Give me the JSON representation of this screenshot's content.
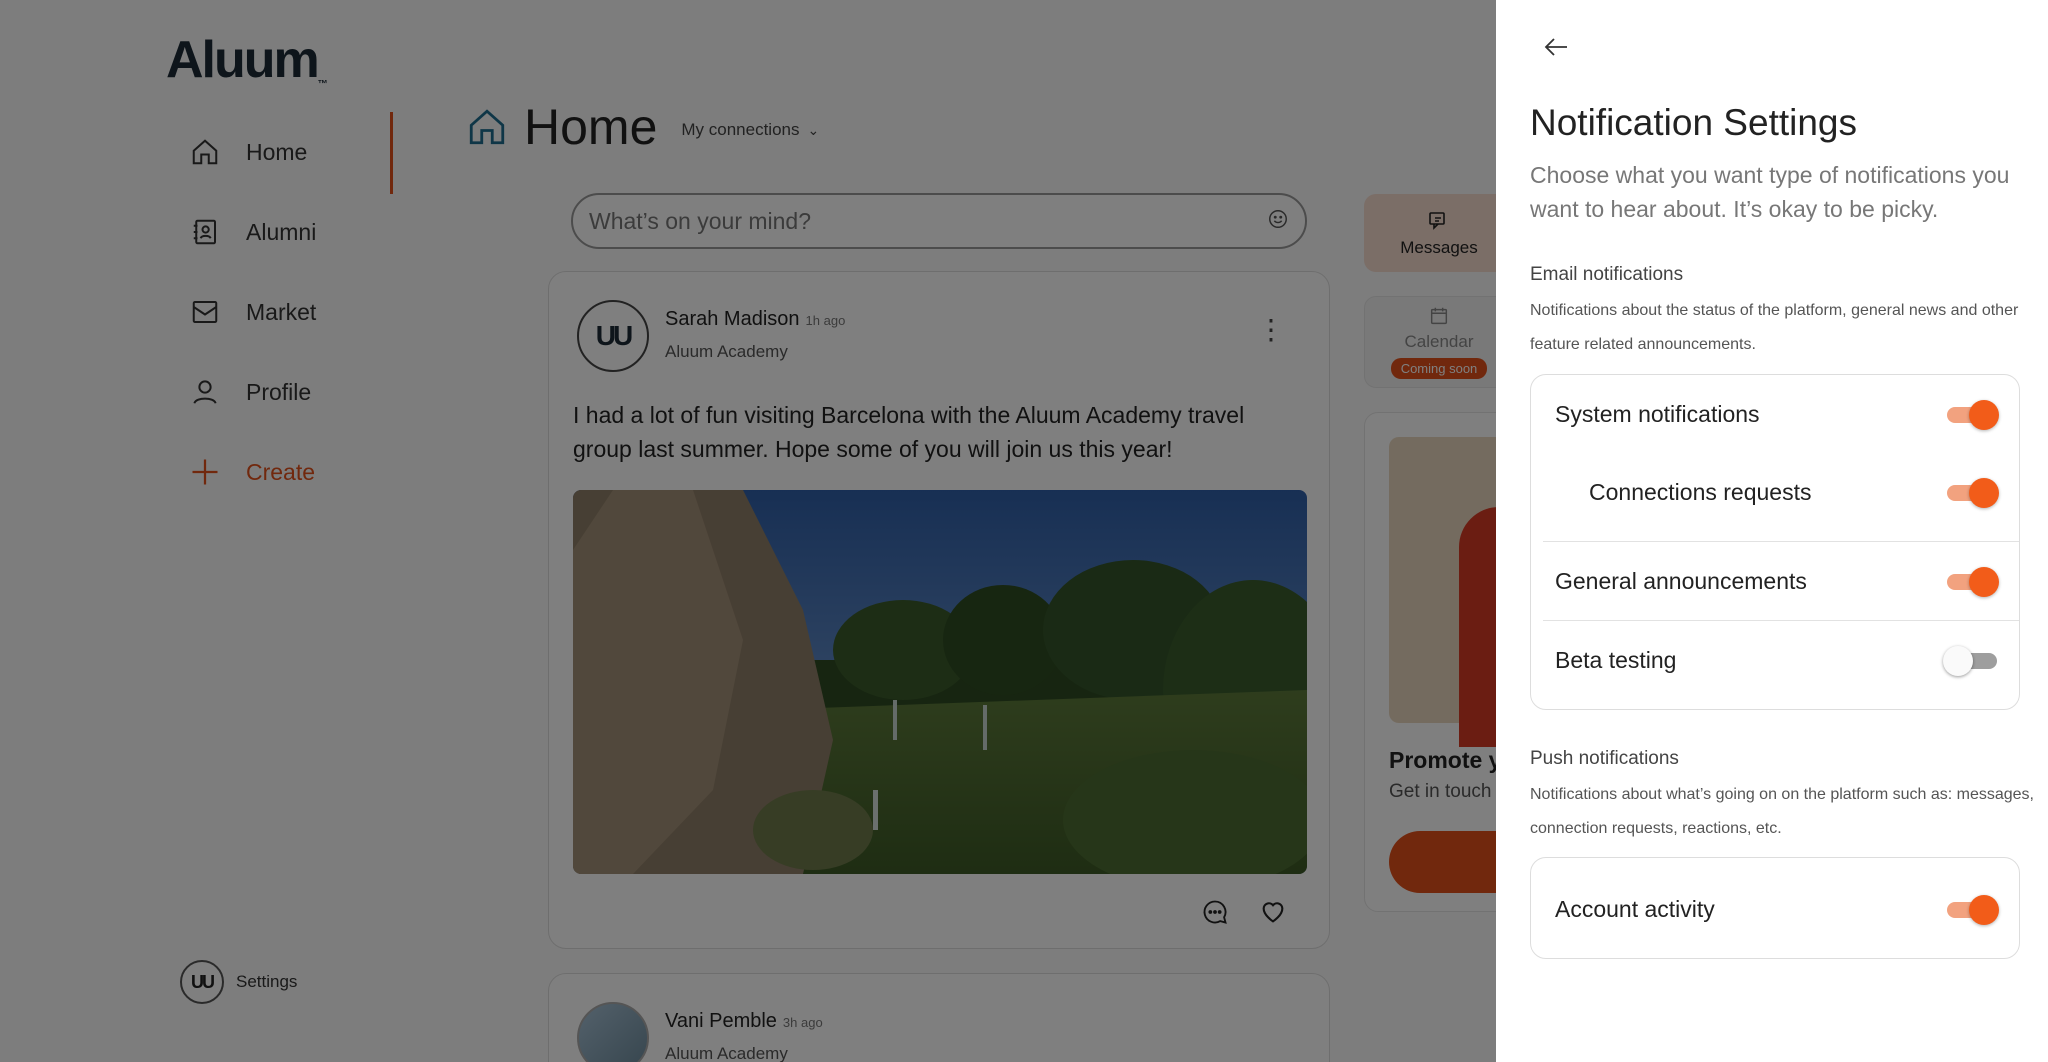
{
  "app": {
    "logo_text": "Aluum",
    "logo_tm": "™",
    "brand_color": "#e2501b"
  },
  "sidebar": {
    "items": [
      {
        "label": "Home",
        "icon": "home-icon",
        "active": true
      },
      {
        "label": "Alumni",
        "icon": "contact-card-icon"
      },
      {
        "label": "Market",
        "icon": "inbox-icon"
      },
      {
        "label": "Profile",
        "icon": "person-icon"
      },
      {
        "label": "Create",
        "icon": "plus-icon"
      }
    ],
    "settings_label": "Settings",
    "settings_avatar": "UU"
  },
  "header": {
    "title": "Home",
    "connections_label": "My connections"
  },
  "composer": {
    "placeholder": "What’s on your mind?"
  },
  "posts": [
    {
      "author": "Sarah Madison",
      "time": "1h ago",
      "org": "Aluum Academy",
      "avatar": "UU",
      "text": "I had a lot of fun visiting Barcelona with the Aluum Academy travel group last summer. Hope some of you will join us this year!",
      "image": "park-fountain-photo"
    },
    {
      "author": "Vani Pemble",
      "time": "3h ago",
      "org": "Aluum Academy"
    }
  ],
  "right_rail": {
    "messages_label": "Messages",
    "calendar_label": "Calendar",
    "calendar_badge": "Coming soon",
    "promo_title": "Promote y",
    "promo_sub": "Get in touch"
  },
  "drawer": {
    "title": "Notification Settings",
    "subtitle": "Choose what you want type of notifications you want to hear about. It’s okay to be picky.",
    "email": {
      "title": "Email notifications",
      "description": "Notifications about the status of the platform, general news and other feature related announcements.",
      "items": [
        {
          "label": "System notifications",
          "on": true
        },
        {
          "label": "Connections requests",
          "on": true
        },
        {
          "label": "General announcements",
          "on": true
        },
        {
          "label": "Beta testing",
          "on": false
        }
      ]
    },
    "push": {
      "title": "Push notifications",
      "description": "Notifications about what’s going on on the platform such as: messages, connection requests, reactions, etc.",
      "items": [
        {
          "label": "Account activity",
          "on": true
        }
      ]
    },
    "toggle_on_color": "#f25c19",
    "toggle_off_color": "#9e9e9e"
  }
}
